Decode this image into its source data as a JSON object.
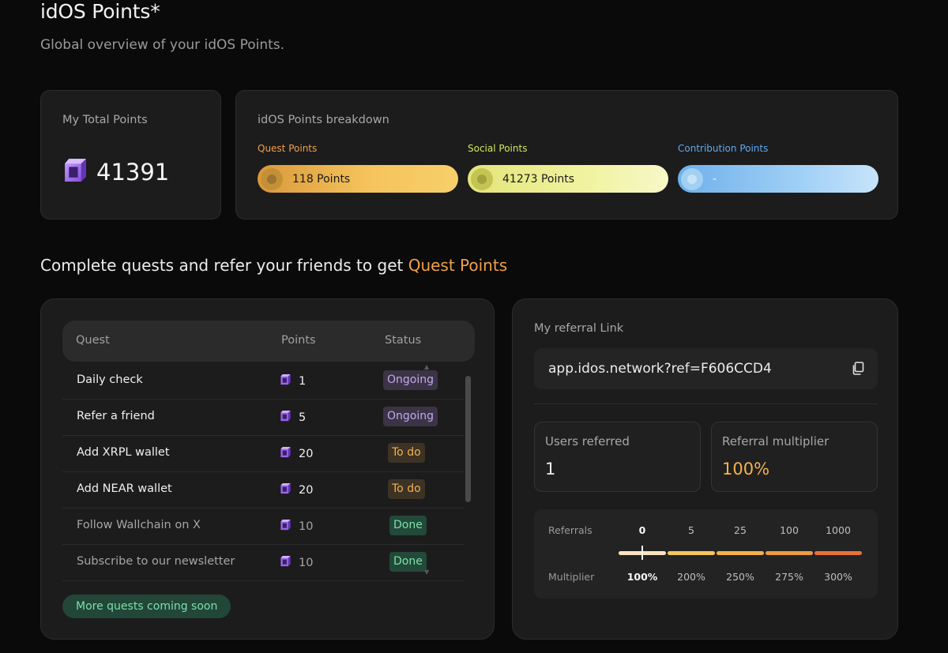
{
  "page": {
    "title": "idOS Points*",
    "subtitle": "Global overview of your idOS Points."
  },
  "total": {
    "label": "My Total Points",
    "value": "41391",
    "icon": "cube-points-icon"
  },
  "breakdown": {
    "label": "idOS Points breakdown",
    "items": [
      {
        "label": "Quest Points",
        "value": "118 Points",
        "label_color": "#f0a048"
      },
      {
        "label": "Social Points",
        "value": "41273 Points",
        "label_color": "#d4e85a"
      },
      {
        "label": "Contribution Points",
        "value": "-",
        "label_color": "#5ea8ef"
      }
    ]
  },
  "section": {
    "heading_prefix": "Complete quests and refer your friends to get ",
    "heading_accent": "Quest Points"
  },
  "quests": {
    "columns": [
      "Quest",
      "Points",
      "Status"
    ],
    "rows": [
      {
        "name": "Daily check",
        "points": "1",
        "status": "Ongoing",
        "state": "ongoing"
      },
      {
        "name": "Refer a friend",
        "points": "5",
        "status": "Ongoing",
        "state": "ongoing"
      },
      {
        "name": "Add XRPL wallet",
        "points": "20",
        "status": "To do",
        "state": "todo"
      },
      {
        "name": "Add NEAR wallet",
        "points": "20",
        "status": "To do",
        "state": "todo"
      },
      {
        "name": "Follow Wallchain on X",
        "points": "10",
        "status": "Done",
        "state": "done"
      },
      {
        "name": "Subscribe to our newsletter",
        "points": "10",
        "status": "Done",
        "state": "done"
      }
    ],
    "more_label": "More quests coming soon"
  },
  "referral": {
    "label": "My referral Link",
    "link": "app.idos.network?ref=F606CCD4",
    "copy_icon": "copy-icon",
    "users_label": "Users referred",
    "users_value": "1",
    "multiplier_label": "Referral multiplier",
    "multiplier_value": "100%",
    "tiers": {
      "referrals_label": "Referrals",
      "multiplier_row_label": "Multiplier",
      "referrals": [
        "0",
        "5",
        "25",
        "100",
        "1000"
      ],
      "multipliers": [
        "100%",
        "200%",
        "250%",
        "275%",
        "300%"
      ],
      "current_index": 0,
      "colors": [
        "#fbe3c0",
        "#f6c55a",
        "#f4b04c",
        "#ef9a42",
        "#e8713a"
      ]
    }
  }
}
